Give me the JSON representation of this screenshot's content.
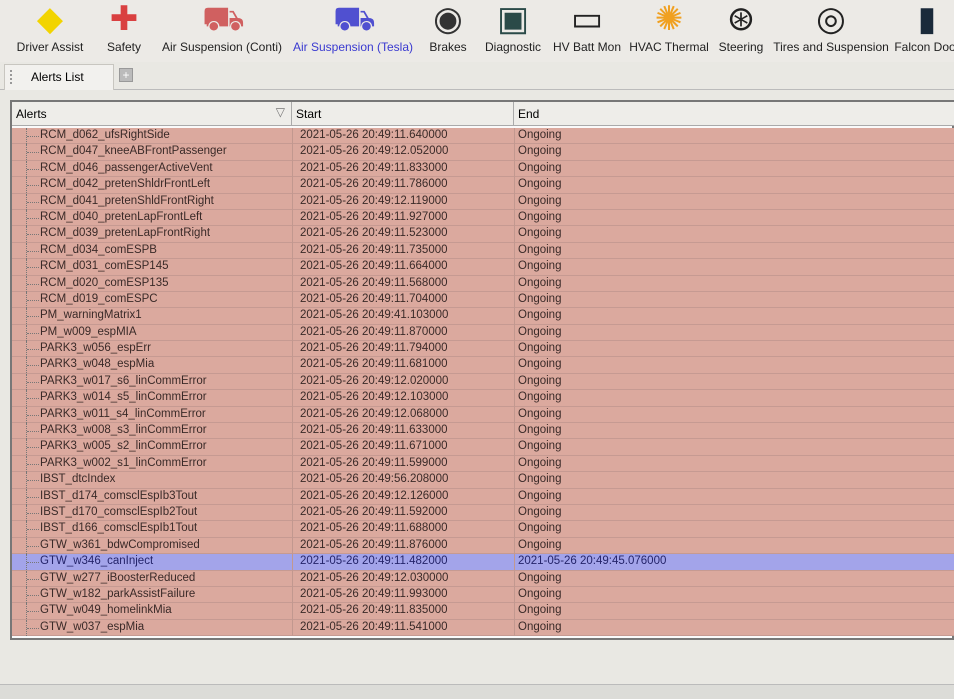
{
  "toolbar": {
    "items": [
      {
        "label": "Driver Assist",
        "icon": "driver-assist-icon",
        "color": "#f2d400"
      },
      {
        "label": "Safety",
        "icon": "safety-cross-icon",
        "color": "#d94040"
      },
      {
        "label": "Air Suspension (Conti)",
        "icon": "air-suspension-icon",
        "color": "#d06060"
      },
      {
        "label": "Air Suspension (Tesla)",
        "icon": "air-suspension-icon",
        "color": "#5050d0"
      },
      {
        "label": "Brakes",
        "icon": "brake-disc-icon",
        "color": "#333333"
      },
      {
        "label": "Diagnostic",
        "icon": "diagnostic-monitor-icon",
        "color": "#2a4a48"
      },
      {
        "label": "HV Batt Mon",
        "icon": "battery-icon",
        "color": "#222222"
      },
      {
        "label": "HVAC Thermal",
        "icon": "hvac-thermal-icon",
        "color": "#f0a020"
      },
      {
        "label": "Steering",
        "icon": "steering-wheel-icon",
        "color": "#222222"
      },
      {
        "label": "Tires and Suspension",
        "icon": "tire-icon",
        "color": "#222222"
      },
      {
        "label": "Falcon Door",
        "icon": "falcon-door-icon",
        "color": "#1a2a3a"
      }
    ],
    "active": "Air Suspension (Tesla)"
  },
  "tabs": {
    "alerts_list": "Alerts List",
    "add": "+"
  },
  "table": {
    "columns": [
      "Alerts",
      "Start",
      "End"
    ],
    "rows": [
      [
        "RCM_d062_ufsRightSide",
        "2021-05-26 20:49:11.640000",
        "Ongoing"
      ],
      [
        "RCM_d047_kneeABFrontPassenger",
        "2021-05-26 20:49:12.052000",
        "Ongoing"
      ],
      [
        "RCM_d046_passengerActiveVent",
        "2021-05-26 20:49:11.833000",
        "Ongoing"
      ],
      [
        "RCM_d042_pretenShldrFrontLeft",
        "2021-05-26 20:49:11.786000",
        "Ongoing"
      ],
      [
        "RCM_d041_pretenShldFrontRight",
        "2021-05-26 20:49:12.119000",
        "Ongoing"
      ],
      [
        "RCM_d040_pretenLapFrontLeft",
        "2021-05-26 20:49:11.927000",
        "Ongoing"
      ],
      [
        "RCM_d039_pretenLapFrontRight",
        "2021-05-26 20:49:11.523000",
        "Ongoing"
      ],
      [
        "RCM_d034_comESPB",
        "2021-05-26 20:49:11.735000",
        "Ongoing"
      ],
      [
        "RCM_d031_comESP145",
        "2021-05-26 20:49:11.664000",
        "Ongoing"
      ],
      [
        "RCM_d020_comESP135",
        "2021-05-26 20:49:11.568000",
        "Ongoing"
      ],
      [
        "RCM_d019_comESPC",
        "2021-05-26 20:49:11.704000",
        "Ongoing"
      ],
      [
        "PM_warningMatrix1",
        "2021-05-26 20:49:41.103000",
        "Ongoing"
      ],
      [
        "PM_w009_espMIA",
        "2021-05-26 20:49:11.870000",
        "Ongoing"
      ],
      [
        "PARK3_w056_espErr",
        "2021-05-26 20:49:11.794000",
        "Ongoing"
      ],
      [
        "PARK3_w048_espMia",
        "2021-05-26 20:49:11.681000",
        "Ongoing"
      ],
      [
        "PARK3_w017_s6_linCommError",
        "2021-05-26 20:49:12.020000",
        "Ongoing"
      ],
      [
        "PARK3_w014_s5_linCommError",
        "2021-05-26 20:49:12.103000",
        "Ongoing"
      ],
      [
        "PARK3_w011_s4_linCommError",
        "2021-05-26 20:49:12.068000",
        "Ongoing"
      ],
      [
        "PARK3_w008_s3_linCommError",
        "2021-05-26 20:49:11.633000",
        "Ongoing"
      ],
      [
        "PARK3_w005_s2_linCommError",
        "2021-05-26 20:49:11.671000",
        "Ongoing"
      ],
      [
        "PARK3_w002_s1_linCommError",
        "2021-05-26 20:49:11.599000",
        "Ongoing"
      ],
      [
        "IBST_dtcIndex",
        "2021-05-26 20:49:56.208000",
        "Ongoing"
      ],
      [
        "IBST_d174_comsclEspIb3Tout",
        "2021-05-26 20:49:12.126000",
        "Ongoing"
      ],
      [
        "IBST_d170_comsclEspIb2Tout",
        "2021-05-26 20:49:11.592000",
        "Ongoing"
      ],
      [
        "IBST_d166_comsclEspIb1Tout",
        "2021-05-26 20:49:11.688000",
        "Ongoing"
      ],
      [
        "GTW_w361_bdwCompromised",
        "2021-05-26 20:49:11.876000",
        "Ongoing"
      ],
      [
        "GTW_w346_canInject",
        "2021-05-26 20:49:11.482000",
        "2021-05-26 20:49:45.076000"
      ],
      [
        "GTW_w277_iBoosterReduced",
        "2021-05-26 20:49:12.030000",
        "Ongoing"
      ],
      [
        "GTW_w182_parkAssistFailure",
        "2021-05-26 20:49:11.993000",
        "Ongoing"
      ],
      [
        "GTW_w049_homelinkMia",
        "2021-05-26 20:49:11.835000",
        "Ongoing"
      ],
      [
        "GTW_w037_espMia",
        "2021-05-26 20:49:11.541000",
        "Ongoing"
      ]
    ],
    "selected_row": 26
  },
  "colors": {
    "alert_row": "#dba99e",
    "selected_row": "#a3a4ea"
  }
}
